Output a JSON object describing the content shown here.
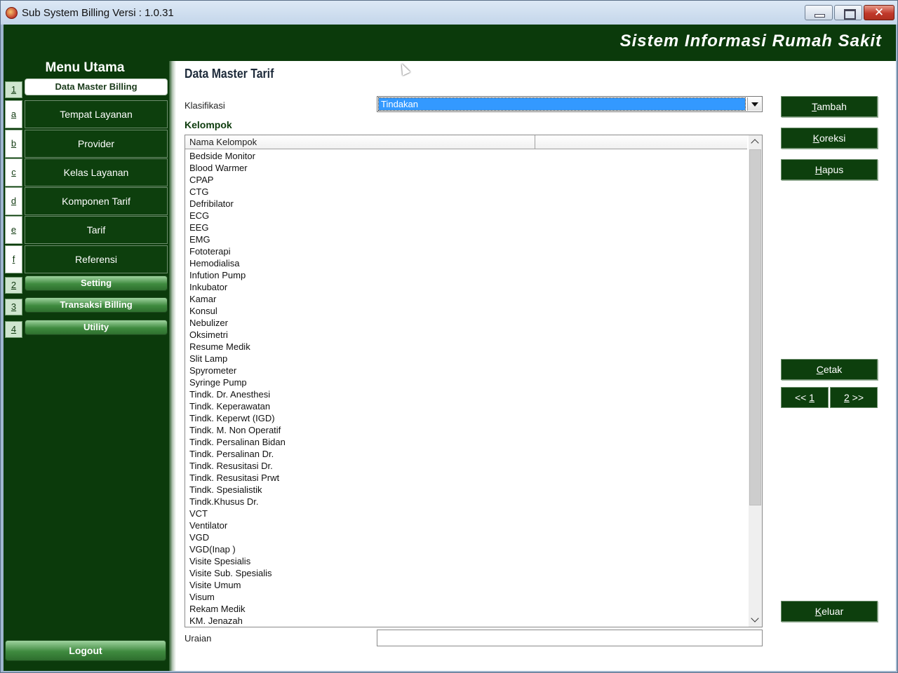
{
  "window": {
    "title": "Sub System Billing Versi : 1.0.31",
    "close_label": "✕"
  },
  "header": {
    "title": "Sistem Informasi Rumah Sakit"
  },
  "sidebar": {
    "title": "Menu Utama",
    "sections": [
      {
        "num": "1",
        "label": "Data Master Billing"
      },
      {
        "num": "2",
        "label": "Setting"
      },
      {
        "num": "3",
        "label": "Transaksi Billing"
      },
      {
        "num": "4",
        "label": "Utility"
      }
    ],
    "sub_items": [
      {
        "key": "a",
        "label": "Tempat Layanan"
      },
      {
        "key": "b",
        "label": "Provider"
      },
      {
        "key": "c",
        "label": "Kelas Layanan"
      },
      {
        "key": "d",
        "label": "Komponen Tarif"
      },
      {
        "key": "e",
        "label": "Tarif"
      },
      {
        "key": "f",
        "label": "Referensi"
      }
    ],
    "logout_label": "Logout"
  },
  "main": {
    "page_title": "Data Master Tarif",
    "klasifikasi_label": "Klasifikasi",
    "klasifikasi_value": "Tindakan",
    "kelompok_label": "Kelompok",
    "grid_header": "Nama Kelompok",
    "grid_rows": [
      "Bedside Monitor",
      "Blood Warmer",
      "CPAP",
      "CTG",
      "Defribilator",
      "ECG",
      "EEG",
      "EMG",
      "Fototerapi",
      "Hemodialisa",
      "Infution Pump",
      "Inkubator",
      "Kamar",
      "Konsul",
      "Nebulizer",
      "Oksimetri",
      "Resume Medik",
      "Slit Lamp",
      "Spyrometer",
      "Syringe Pump",
      "Tindk. Dr. Anesthesi",
      "Tindk. Keperawatan",
      "Tindk. Keperwt (IGD)",
      "Tindk. M. Non Operatif",
      "Tindk. Persalinan Bidan",
      "Tindk. Persalinan Dr.",
      "Tindk. Resusitasi Dr.",
      "Tindk. Resusitasi Prwt",
      "Tindk. Spesialistik",
      "Tindk.Khusus Dr.",
      "VCT",
      "Ventilator",
      "VGD",
      "VGD(Inap )",
      "Visite Spesialis",
      "Visite Sub. Spesialis",
      "Visite Umum",
      "Visum",
      "Rekam Medik",
      "KM. Jenazah"
    ],
    "uraian_label": "Uraian",
    "uraian_value": ""
  },
  "actions": {
    "tambah": {
      "hot": "T",
      "rest": "ambah"
    },
    "koreksi": {
      "hot": "K",
      "rest": "oreksi"
    },
    "hapus": {
      "hot": "H",
      "rest": "apus"
    },
    "cetak": {
      "hot": "C",
      "rest": "etak"
    },
    "prev": {
      "pre": "<< ",
      "hot": "1"
    },
    "next": {
      "hot": "2",
      "post": " >>"
    },
    "keluar": {
      "hot": "K",
      "rest": "eluar"
    }
  }
}
